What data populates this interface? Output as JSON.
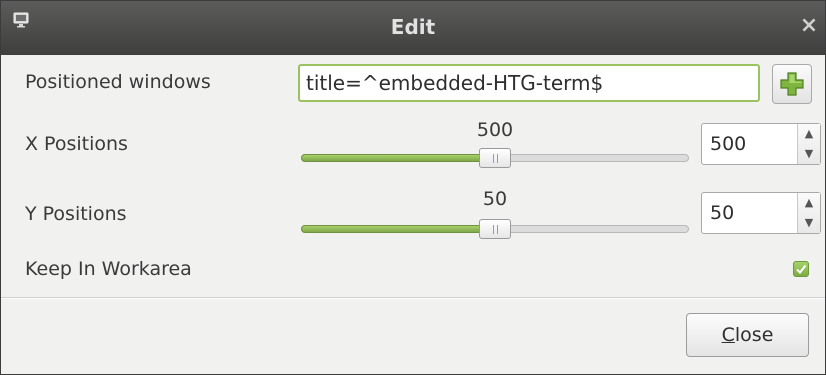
{
  "window": {
    "title": "Edit",
    "close_glyph": "×",
    "app_icon": "monitor-icon"
  },
  "form": {
    "positioned_windows": {
      "label": "Positioned windows",
      "value": "title=^embedded-HTG-term$",
      "add_icon": "plus-icon"
    },
    "x_positions": {
      "label": "X Positions",
      "slider_value": "500",
      "slider_fraction": 0.5,
      "spin_value": "500"
    },
    "y_positions": {
      "label": "Y Positions",
      "slider_value": "50",
      "slider_fraction": 0.5,
      "spin_value": "50"
    },
    "keep_in_workarea": {
      "label": "Keep In Workarea",
      "checked": true
    }
  },
  "footer": {
    "close_mnemonic": "C",
    "close_rest": "lose"
  },
  "colors": {
    "accent_green": "#8fbf57",
    "titlebar": "#4a4a49"
  }
}
